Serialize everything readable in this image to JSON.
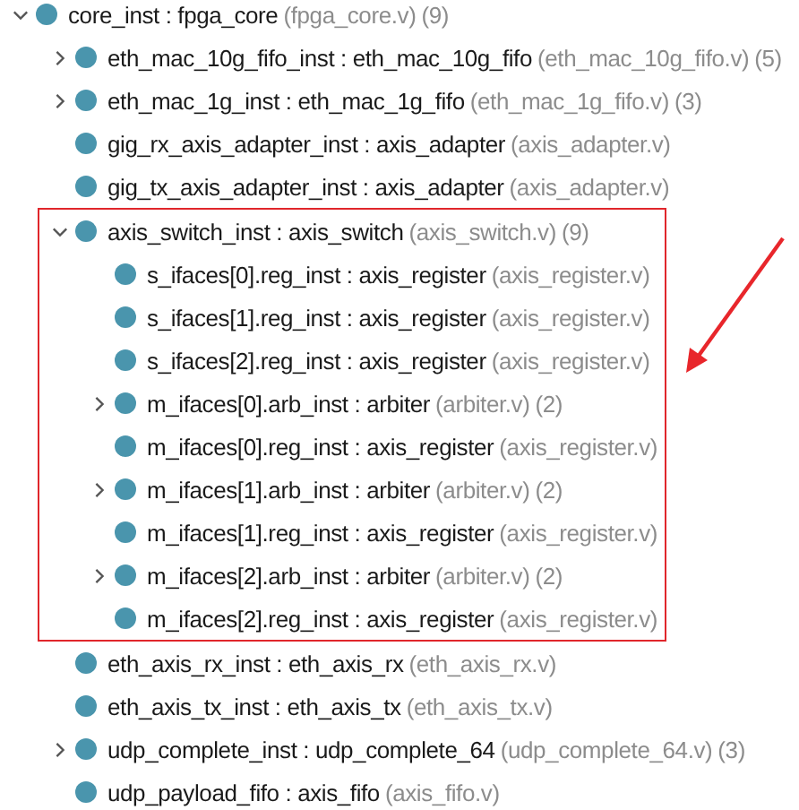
{
  "tree": [
    {
      "label": "core_inst : fpga_core",
      "file": "(fpga_core.v)",
      "count": "(9)",
      "expanded": true,
      "children": [
        {
          "label": "eth_mac_10g_fifo_inst : eth_mac_10g_fifo",
          "file": "(eth_mac_10g_fifo.v)",
          "count": "(5)",
          "expanded": false
        },
        {
          "label": "eth_mac_1g_inst : eth_mac_1g_fifo",
          "file": "(eth_mac_1g_fifo.v)",
          "count": "(3)",
          "expanded": false
        },
        {
          "label": "gig_rx_axis_adapter_inst : axis_adapter",
          "file": "(axis_adapter.v)"
        },
        {
          "label": "gig_tx_axis_adapter_inst : axis_adapter",
          "file": "(axis_adapter.v)"
        },
        {
          "label": "axis_switch_inst : axis_switch",
          "file": "(axis_switch.v)",
          "count": "(9)",
          "expanded": true,
          "highlighted": true,
          "arrow": true,
          "children": [
            {
              "label": "s_ifaces[0].reg_inst : axis_register",
              "file": "(axis_register.v)"
            },
            {
              "label": "s_ifaces[1].reg_inst : axis_register",
              "file": "(axis_register.v)"
            },
            {
              "label": "s_ifaces[2].reg_inst : axis_register",
              "file": "(axis_register.v)"
            },
            {
              "label": "m_ifaces[0].arb_inst : arbiter",
              "file": "(arbiter.v)",
              "count": "(2)",
              "expanded": false
            },
            {
              "label": "m_ifaces[0].reg_inst : axis_register",
              "file": "(axis_register.v)"
            },
            {
              "label": "m_ifaces[1].arb_inst : arbiter",
              "file": "(arbiter.v)",
              "count": "(2)",
              "expanded": false
            },
            {
              "label": "m_ifaces[1].reg_inst : axis_register",
              "file": "(axis_register.v)"
            },
            {
              "label": "m_ifaces[2].arb_inst : arbiter",
              "file": "(arbiter.v)",
              "count": "(2)",
              "expanded": false
            },
            {
              "label": "m_ifaces[2].reg_inst : axis_register",
              "file": "(axis_register.v)"
            }
          ]
        },
        {
          "label": "eth_axis_rx_inst : eth_axis_rx",
          "file": "(eth_axis_rx.v)"
        },
        {
          "label": "eth_axis_tx_inst : eth_axis_tx",
          "file": "(eth_axis_tx.v)"
        },
        {
          "label": "udp_complete_inst : udp_complete_64",
          "file": "(udp_complete_64.v)",
          "count": "(3)",
          "expanded": false
        },
        {
          "label": "udp_payload_fifo : axis_fifo",
          "file": "(axis_fifo.v)"
        }
      ]
    }
  ]
}
